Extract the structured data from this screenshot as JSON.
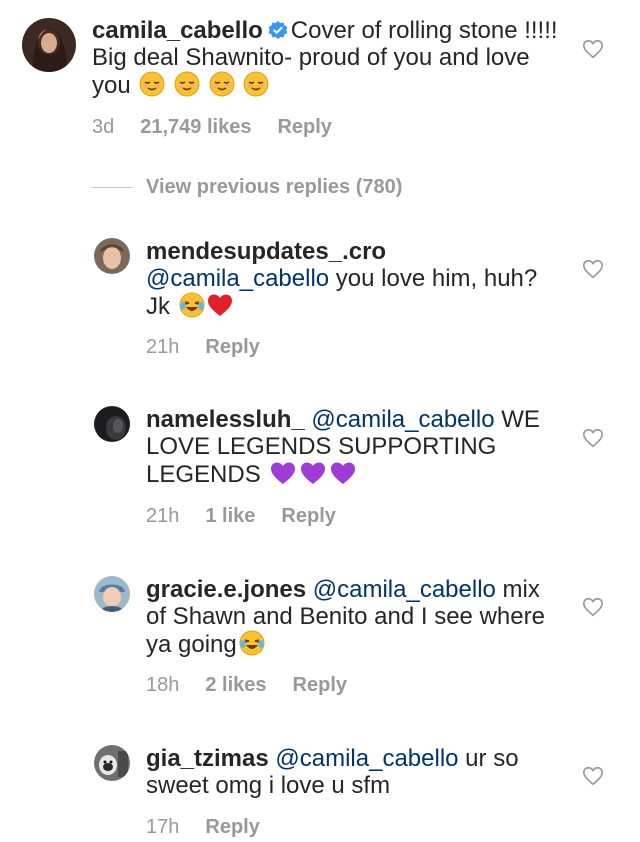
{
  "main_comment": {
    "username": "camila_cabello",
    "text_before": "Cover of rolling stone !!!!! Big deal Shawnito- proud of you and love you",
    "emoji": "relieved-face-emoji x4",
    "time": "3d",
    "likes": "21,749 likes",
    "reply": "Reply"
  },
  "view_replies": "View previous replies (780)",
  "replies": [
    {
      "username": "mendesupdates_.cro",
      "mention": "@camila_cabello",
      "text": " you love him, huh? Jk",
      "time": "21h",
      "likes": "",
      "reply": "Reply"
    },
    {
      "username": "namelessluh_",
      "mention": "@camila_cabello",
      "text": " WE LOVE LEGENDS SUPPORTING LEGENDS",
      "time": "21h",
      "likes": "1 like",
      "reply": "Reply"
    },
    {
      "username": "gracie.e.jones",
      "mention": "@camila_cabello",
      "text": " mix of Shawn and Benito and I see where ya going",
      "time": "18h",
      "likes": "2 likes",
      "reply": "Reply"
    },
    {
      "username": "gia_tzimas",
      "mention": "@camila_cabello",
      "text": " ur so sweet omg i love u sfm",
      "time": "17h",
      "likes": "",
      "reply": "Reply"
    }
  ],
  "colors": {
    "text": "#262626",
    "meta": "#999999",
    "mention": "#003569",
    "verified": "#3897f0"
  }
}
